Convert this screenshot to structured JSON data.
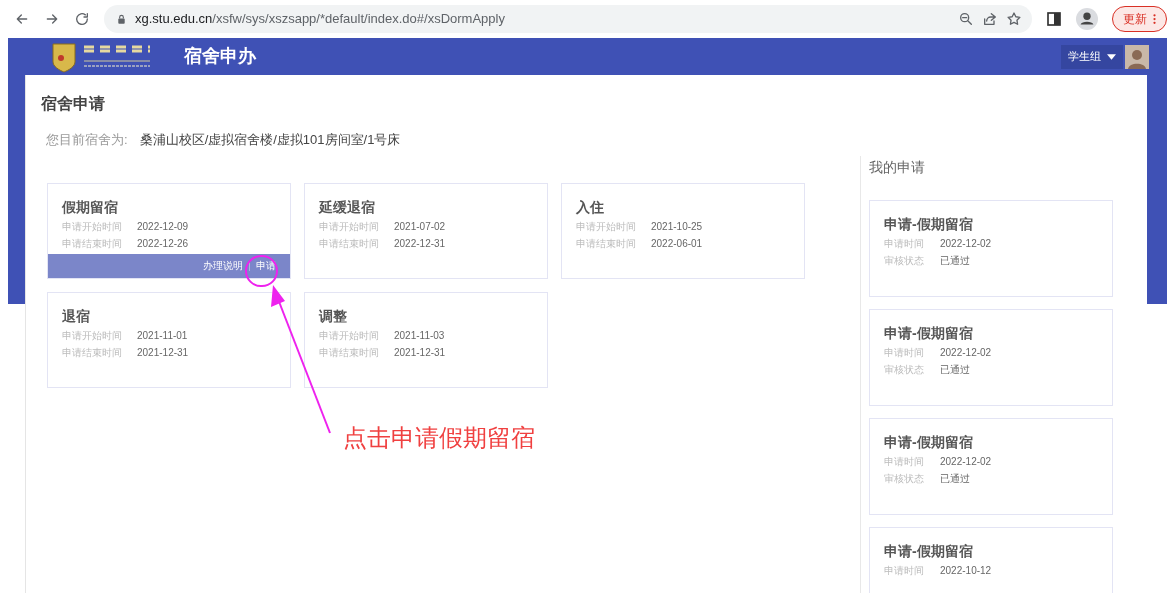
{
  "browser": {
    "url_host": "xg.stu.edu.cn",
    "url_path": "/xsfw/sys/xszsapp/*default/index.do#/xsDormApply",
    "update_button": "更新"
  },
  "header": {
    "title": "宿舍申办",
    "user_menu": "学生组"
  },
  "page": {
    "title": "宿舍申请",
    "dorm_label": "您目前宿舍为:",
    "dorm_value": "桑浦山校区/虚拟宿舍楼/虚拟101房间室/1号床"
  },
  "services": [
    {
      "title": "假期留宿",
      "start_label": "申请开始时间",
      "start": "2022-12-09",
      "end_label": "申请结束时间",
      "end": "2022-12-26",
      "actions": [
        "办理说明",
        "申请"
      ]
    },
    {
      "title": "延缓退宿",
      "start_label": "申请开始时间",
      "start": "2021-07-02",
      "end_label": "申请结束时间",
      "end": "2022-12-31"
    },
    {
      "title": "入住",
      "start_label": "申请开始时间",
      "start": "2021-10-25",
      "end_label": "申请结束时间",
      "end": "2022-06-01"
    },
    {
      "title": "退宿",
      "start_label": "申请开始时间",
      "start": "2021-11-01",
      "end_label": "申请结束时间",
      "end": "2021-12-31"
    },
    {
      "title": "调整",
      "start_label": "申请开始时间",
      "start": "2021-11-03",
      "end_label": "申请结束时间",
      "end": "2021-12-31"
    }
  ],
  "my_applications": {
    "title": "我的申请",
    "items": [
      {
        "title": "申请-假期留宿",
        "time_label": "申请时间",
        "time": "2022-12-02",
        "status_label": "审核状态",
        "status": "已通过"
      },
      {
        "title": "申请-假期留宿",
        "time_label": "申请时间",
        "time": "2022-12-02",
        "status_label": "审核状态",
        "status": "已通过"
      },
      {
        "title": "申请-假期留宿",
        "time_label": "申请时间",
        "time": "2022-12-02",
        "status_label": "审核状态",
        "status": "已通过"
      },
      {
        "title": "申请-假期留宿",
        "time_label": "申请时间",
        "time": "2022-10-12"
      }
    ]
  },
  "annotation": {
    "text": "点击申请假期留宿"
  }
}
